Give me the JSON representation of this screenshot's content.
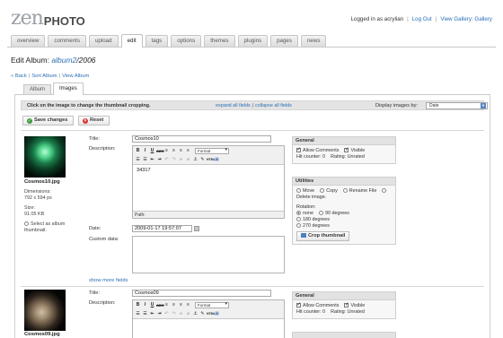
{
  "header": {
    "logo_zen": "zen",
    "logo_photo": "PHOTO",
    "logged_in": "Logged in as acrylian",
    "logout": "Log Out",
    "view_gallery": "View Gallery: Gallery"
  },
  "nav": {
    "tabs": [
      "overview",
      "comments",
      "upload",
      "edit",
      "tags",
      "options",
      "themes",
      "plugins",
      "pages",
      "news"
    ],
    "active": "edit"
  },
  "page": {
    "title_prefix": "Edit Album:",
    "album_link": "album2",
    "album_rest": "/2006"
  },
  "crumbs": {
    "back": "« Back",
    "sort": "Sort Album",
    "view": "View Album"
  },
  "subtabs": [
    "Album",
    "Images"
  ],
  "infobar": {
    "hint": "Click on the image to change the thumbnail cropping.",
    "expand": "expand all fields",
    "collapse": "collapse all fields",
    "display_label": "Display images by:",
    "display_value": "Date"
  },
  "buttons": {
    "save": "Save changes",
    "reset": "Reset"
  },
  "images": [
    {
      "filename": "Cosmos10.jpg",
      "dimensions_label": "Dimensions:",
      "dimensions": "792 x 594 px",
      "size_label": "Size:",
      "size": "91.05 KB",
      "thumb_select": "Select as album thumbnail.",
      "title_label": "Title:",
      "title": "Cosmos10",
      "description_label": "Description:",
      "description": "34317",
      "path_label": "Path:",
      "date_label": "Date:",
      "date": "2009-01-17 19:57:07",
      "custom_label": "Custom data:",
      "show_more": "show more fields"
    },
    {
      "filename": "Cosmos09.jpg",
      "title_label": "Title:",
      "title": "Cosmos09",
      "description_label": "Description:"
    }
  ],
  "editor": {
    "format": "Format"
  },
  "general_box": {
    "title": "General",
    "allow_comments": "Allow Comments",
    "visible": "Visible",
    "hit_counter": "Hit counter: 0",
    "rating": "Rating: Unrated"
  },
  "utilities_box": {
    "title": "Utilities",
    "move": "Move",
    "copy": "Copy",
    "rename": "Rename File",
    "delete": "Delete image.",
    "rotation_label": "Rotation:",
    "rotations": [
      "none",
      "90 degrees",
      "180 degrees",
      "270 degrees"
    ],
    "crop": "Crop thumbnail"
  }
}
